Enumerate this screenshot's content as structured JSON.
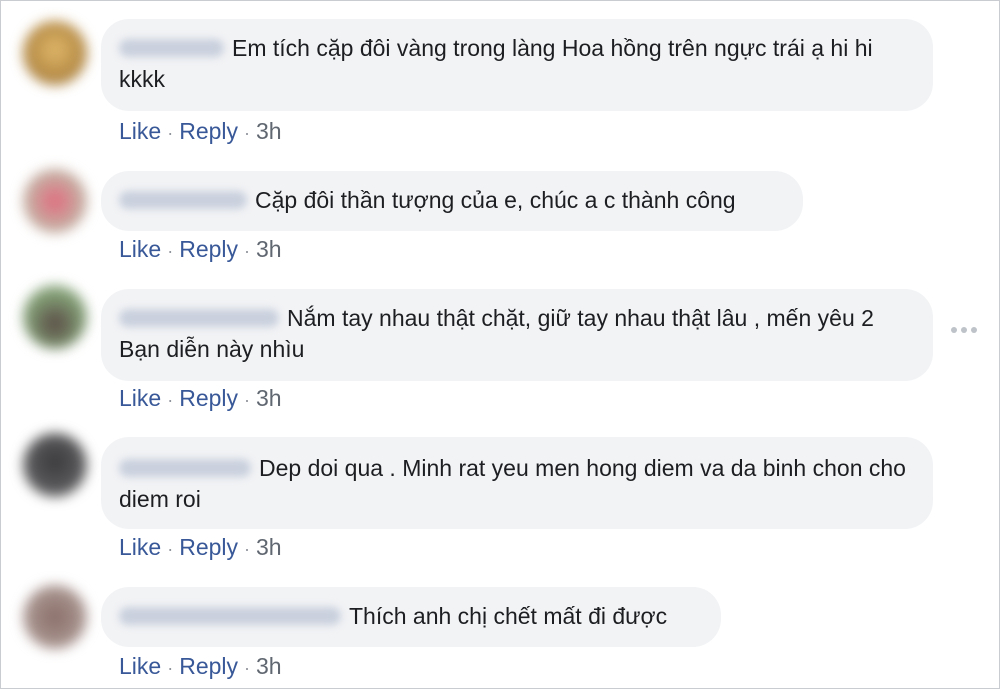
{
  "comments": [
    {
      "text": "Em tích cặp đôi vàng trong làng Hoa hồng trên ngực trái ạ hi hi kkkk",
      "like": "Like",
      "reply": "Reply",
      "time": "3h",
      "avatar_color": "#c9a35a"
    },
    {
      "text": "Cặp đôi thần tượng của e, chúc a c thành công",
      "like": "Like",
      "reply": "Reply",
      "time": "3h",
      "avatar_color": "#d98a96"
    },
    {
      "text": "Nắm tay nhau thật chặt, giữ tay nhau thật lâu , mến yêu 2 Bạn diễn này nhìu",
      "like": "Like",
      "reply": "Reply",
      "time": "3h",
      "avatar_color": "#6f8a66"
    },
    {
      "text": "Dep doi qua . Minh rat yeu men hong diem va da binh chon cho diem roi",
      "like": "Like",
      "reply": "Reply",
      "time": "3h",
      "avatar_color": "#555557"
    },
    {
      "text": "Thích anh chị chết mất đi được",
      "like": "Like",
      "reply": "Reply",
      "time": "3h",
      "avatar_color": "#9b847f"
    }
  ],
  "separator": "·",
  "more_options_icon": "horizontal-ellipsis-icon"
}
